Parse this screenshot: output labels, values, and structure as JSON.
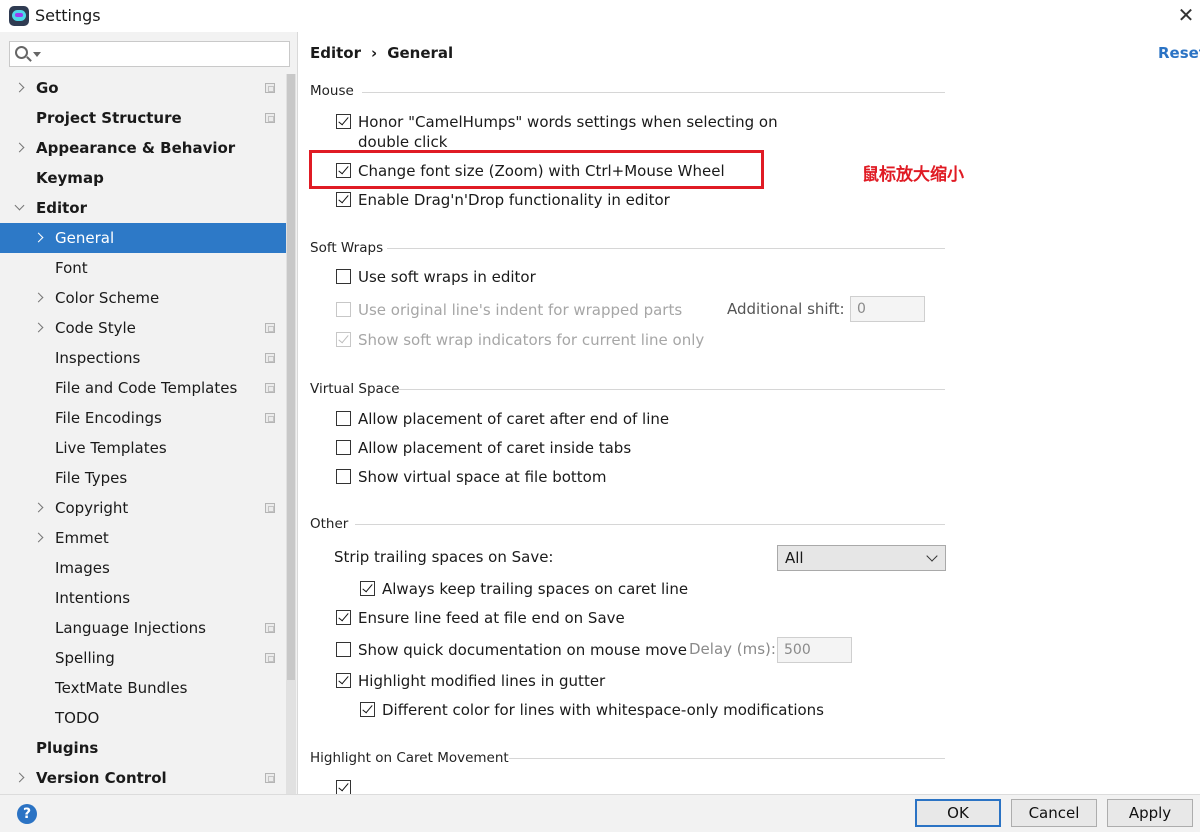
{
  "window": {
    "title": "Settings",
    "close": "✕"
  },
  "search": {
    "placeholder": ""
  },
  "sidebar": {
    "items": [
      {
        "label": "Go",
        "bold": true,
        "indent": 0,
        "arrow": "right",
        "proj": true
      },
      {
        "label": "Project Structure",
        "bold": true,
        "indent": 0,
        "arrow": "none",
        "proj": true
      },
      {
        "label": "Appearance & Behavior",
        "bold": true,
        "indent": 0,
        "arrow": "right",
        "proj": false
      },
      {
        "label": "Keymap",
        "bold": true,
        "indent": 0,
        "arrow": "none",
        "proj": false
      },
      {
        "label": "Editor",
        "bold": true,
        "indent": 0,
        "arrow": "down",
        "proj": false
      },
      {
        "label": "General",
        "bold": false,
        "indent": 1,
        "arrow": "right",
        "proj": false,
        "selected": true
      },
      {
        "label": "Font",
        "bold": false,
        "indent": 1,
        "arrow": "none",
        "proj": false
      },
      {
        "label": "Color Scheme",
        "bold": false,
        "indent": 1,
        "arrow": "right",
        "proj": false
      },
      {
        "label": "Code Style",
        "bold": false,
        "indent": 1,
        "arrow": "right",
        "proj": true
      },
      {
        "label": "Inspections",
        "bold": false,
        "indent": 1,
        "arrow": "none",
        "proj": true
      },
      {
        "label": "File and Code Templates",
        "bold": false,
        "indent": 1,
        "arrow": "none",
        "proj": true
      },
      {
        "label": "File Encodings",
        "bold": false,
        "indent": 1,
        "arrow": "none",
        "proj": true
      },
      {
        "label": "Live Templates",
        "bold": false,
        "indent": 1,
        "arrow": "none",
        "proj": false
      },
      {
        "label": "File Types",
        "bold": false,
        "indent": 1,
        "arrow": "none",
        "proj": false
      },
      {
        "label": "Copyright",
        "bold": false,
        "indent": 1,
        "arrow": "right",
        "proj": true
      },
      {
        "label": "Emmet",
        "bold": false,
        "indent": 1,
        "arrow": "right",
        "proj": false
      },
      {
        "label": "Images",
        "bold": false,
        "indent": 1,
        "arrow": "none",
        "proj": false
      },
      {
        "label": "Intentions",
        "bold": false,
        "indent": 1,
        "arrow": "none",
        "proj": false
      },
      {
        "label": "Language Injections",
        "bold": false,
        "indent": 1,
        "arrow": "none",
        "proj": true
      },
      {
        "label": "Spelling",
        "bold": false,
        "indent": 1,
        "arrow": "none",
        "proj": true
      },
      {
        "label": "TextMate Bundles",
        "bold": false,
        "indent": 1,
        "arrow": "none",
        "proj": false
      },
      {
        "label": "TODO",
        "bold": false,
        "indent": 1,
        "arrow": "none",
        "proj": false
      },
      {
        "label": "Plugins",
        "bold": true,
        "indent": 0,
        "arrow": "none",
        "proj": false
      },
      {
        "label": "Version Control",
        "bold": true,
        "indent": 0,
        "arrow": "right",
        "proj": true
      }
    ]
  },
  "header": {
    "crumb_parent": "Editor",
    "crumb_sep": "›",
    "crumb_current": "General",
    "reset": "Reset"
  },
  "mouse": {
    "title": "Mouse",
    "camel_line1": "Honor \"CamelHumps\" words settings when selecting on",
    "camel_line2": "double click",
    "zoom": "Change font size (Zoom) with Ctrl+Mouse Wheel",
    "dnd": "Enable Drag'n'Drop functionality in editor",
    "annotation": "鼠标放大缩小"
  },
  "soft_wraps": {
    "title": "Soft Wraps",
    "use_soft": "Use soft wraps in editor",
    "indent": "Use original line's indent for wrapped parts",
    "shift_label": "Additional shift:",
    "shift_value": "0",
    "indicators": "Show soft wrap indicators for current line only"
  },
  "virtual_space": {
    "title": "Virtual Space",
    "after_end": "Allow placement of caret after end of line",
    "inside_tabs": "Allow placement of caret inside tabs",
    "file_bottom": "Show virtual space at file bottom"
  },
  "other": {
    "title": "Other",
    "strip_label": "Strip trailing spaces on Save:",
    "strip_value": "All",
    "keep_trailing": "Always keep trailing spaces on caret line",
    "line_feed": "Ensure line feed at file end on Save",
    "quick_doc": "Show quick documentation on mouse move",
    "delay_label": "Delay (ms):",
    "delay_value": "500",
    "highlight_modified": "Highlight modified lines in gutter",
    "diff_color": "Different color for lines with whitespace-only modifications"
  },
  "caret": {
    "title": "Highlight on Caret Movement"
  },
  "buttons": {
    "help": "?",
    "ok": "OK",
    "cancel": "Cancel",
    "apply": "Apply"
  },
  "colors": {
    "accent": "#2d79c7",
    "annotation": "#e01b24",
    "link": "#2b73c4"
  }
}
